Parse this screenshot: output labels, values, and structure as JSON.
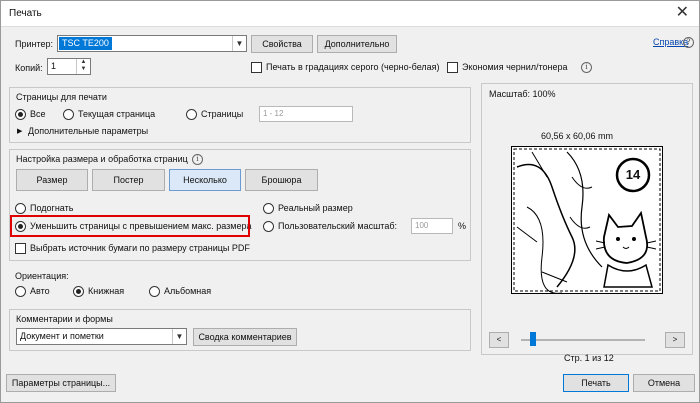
{
  "window": {
    "title": "Печать",
    "close_glyph": "✕"
  },
  "printer": {
    "label": "Принтер:",
    "value": "TSC TE200",
    "properties_btn": "Свойства",
    "advanced_btn": "Дополнительно",
    "help_link": "Справка"
  },
  "copies": {
    "label": "Копий:",
    "value": "1",
    "grayscale_label": "Печать в градациях серого (черно-белая)",
    "ink_save_label": "Экономия чернил/тонера"
  },
  "pages": {
    "title": "Страницы для печати",
    "all": "Все",
    "current": "Текущая страница",
    "pages": "Страницы",
    "range_placeholder": "1 - 12",
    "more": "Дополнительные параметры"
  },
  "sizing": {
    "title": "Настройка размера и обработка страниц",
    "tabs": [
      "Размер",
      "Постер",
      "Несколько",
      "Брошюра"
    ],
    "fit": "Подогнать",
    "actual": "Реальный размер",
    "shrink": "Уменьшить страницы с превышением макс. размера",
    "custom": "Пользовательский масштаб:",
    "custom_value": "100",
    "percent": "%",
    "paper_source": "Выбрать источник бумаги по размеру страницы PDF"
  },
  "orientation": {
    "label": "Ориентация:",
    "auto": "Авто",
    "portrait": "Книжная",
    "landscape": "Альбомная"
  },
  "comments": {
    "title": "Комментарии и формы",
    "value": "Документ и пометки",
    "summary_btn": "Сводка комментариев"
  },
  "preview": {
    "scale": "Масштаб: 100%",
    "dims": "60,56 x 60,06 mm",
    "page_number": "14",
    "page_status": "Стр. 1 из 12",
    "slider_fraction": 0.0
  },
  "footer": {
    "page_setup": "Параметры страницы...",
    "print": "Печать",
    "cancel": "Отмена"
  },
  "colors": {
    "highlight": "#e00000",
    "selection": "#0078d7",
    "link": "#0645ad"
  }
}
